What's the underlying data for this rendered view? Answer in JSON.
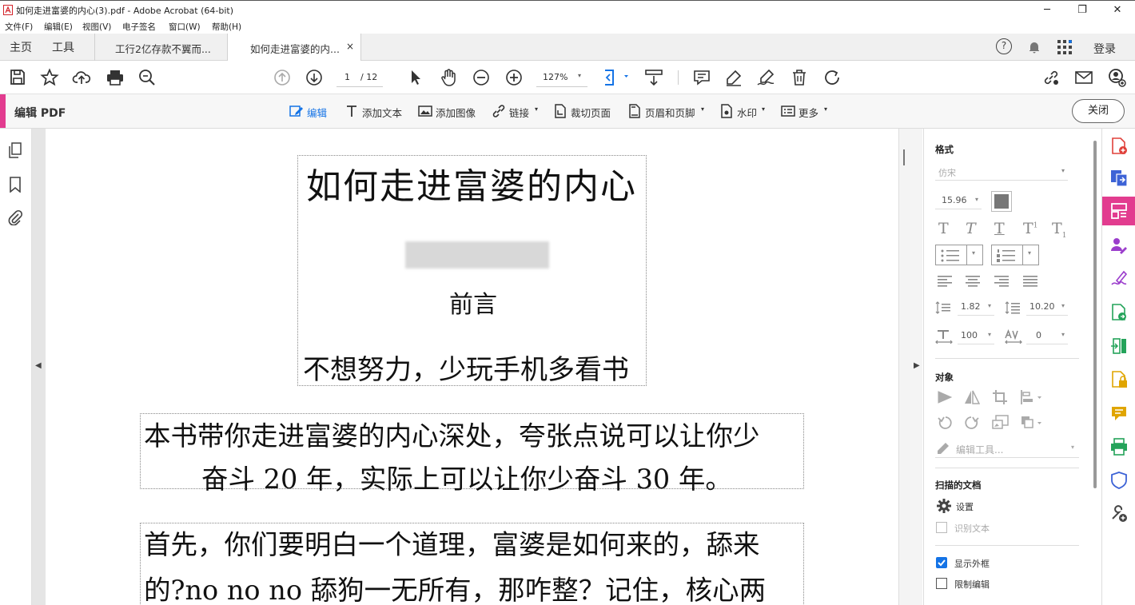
{
  "window": {
    "title": "如何走进富婆的内心(3).pdf - Adobe Acrobat (64-bit)",
    "minimize": "─",
    "restore": "❐",
    "close": "✕"
  },
  "menu": [
    "文件(F)",
    "编辑(E)",
    "视图(V)",
    "电子签名",
    "窗口(W)",
    "帮助(H)"
  ],
  "tabs": {
    "home": "主页",
    "tools": "工具",
    "docs": [
      {
        "label": "工行2亿存款不翼而..."
      },
      {
        "label": "如何走进富婆的内...",
        "close": "×"
      }
    ],
    "help": "?",
    "login": "登录"
  },
  "toolbar": {
    "page_current": "1",
    "page_total": "/ 12",
    "zoom": "127%"
  },
  "edit_bar": {
    "title": "编辑 PDF",
    "tools": [
      "编辑",
      "添加文本",
      "添加图像",
      "链接",
      "裁切页面",
      "页眉和页脚",
      "水印",
      "更多"
    ],
    "dropdown_arrow": "▾",
    "close": "关闭"
  },
  "document": {
    "title": "如何走进富婆的内心",
    "preface": "前言",
    "motto": "不想努力，少玩手机多看书",
    "para1_line1": "本书带你走进富婆的内心深处，夸张点说可以让你少",
    "para1_line2": "奋斗 20 年，实际上可以让你少奋斗 30 年。",
    "para2_line1": "首先，你们要明白一个道理，富婆是如何来的，舔来",
    "para2_line2": "的?no no no 舔狗一无所有，那咋整？记住，核心两"
  },
  "format_panel": {
    "heading": "格式",
    "font": "仿宋",
    "font_size": "15.96",
    "text_color": "#777777",
    "line_spacing": "1.82",
    "para_spacing": "10.20",
    "scale": "100",
    "char_spacing": "0",
    "object_heading": "对象",
    "edit_tools": "编辑工具...",
    "scanned_heading": "扫描的文档",
    "settings": "设置",
    "recognize_text": "识别文本",
    "show_bbox": "显示外框",
    "show_bbox_checked": true,
    "restrict_edit": "限制编辑",
    "restrict_edit_checked": false
  },
  "colors": {
    "accent_pink": "#e23c8f",
    "tool_blue": "#1473e6"
  }
}
